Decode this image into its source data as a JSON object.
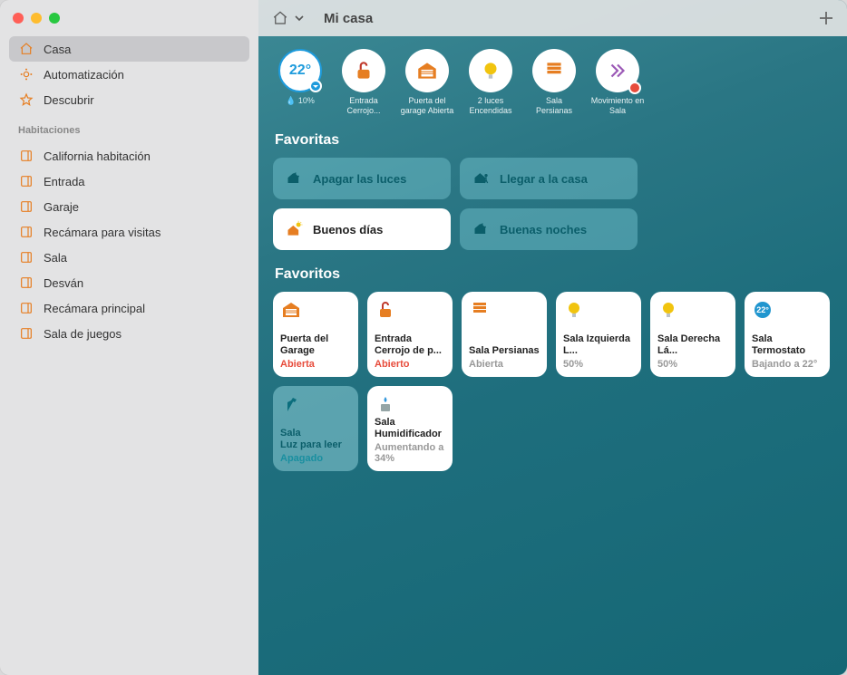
{
  "window": {
    "title": "Mi casa"
  },
  "sidebar": {
    "top": [
      {
        "label": "Casa",
        "icon": "home",
        "selected": true
      },
      {
        "label": "Automatización",
        "icon": "auto",
        "selected": false
      },
      {
        "label": "Descubrir",
        "icon": "star",
        "selected": false
      }
    ],
    "rooms_header": "Habitaciones",
    "rooms": [
      {
        "label": "California habitación"
      },
      {
        "label": "Entrada"
      },
      {
        "label": "Garaje"
      },
      {
        "label": "Recámara para visitas"
      },
      {
        "label": "Sala"
      },
      {
        "label": "Desván"
      },
      {
        "label": "Recámara principal"
      },
      {
        "label": "Sala de juegos"
      }
    ]
  },
  "status": {
    "temp": "22°",
    "humidity": "10%",
    "chips": [
      {
        "label": "Entrada Cerrojo... Abierto",
        "icon": "lock-open"
      },
      {
        "label": "Puerta del garage Abierta",
        "icon": "garage"
      },
      {
        "label": "2 luces Encendidas",
        "icon": "bulb"
      },
      {
        "label": "Sala Persianas Abierta",
        "icon": "blinds"
      },
      {
        "label": "Movimiento en Sala",
        "icon": "motion",
        "alert": true
      }
    ]
  },
  "scenes_header": "Favoritas",
  "scenes": [
    {
      "label": "Apagar las luces",
      "style": "dim"
    },
    {
      "label": "Llegar a la casa",
      "style": "dim"
    },
    {
      "label": "Buenos días",
      "style": "on"
    },
    {
      "label": "Buenas noches",
      "style": "dim"
    }
  ],
  "favorites_header": "Favoritos",
  "favorites": [
    {
      "name": "Puerta del Garage",
      "status": "Abierta",
      "statusClass": "stat-red",
      "icon": "garage",
      "off": false
    },
    {
      "name": "Entrada Cerrojo de p...",
      "status": "Abierto",
      "statusClass": "stat-red",
      "icon": "lock-open",
      "off": false
    },
    {
      "name": "Sala Persianas",
      "status": "Abierta",
      "statusClass": "stat-gray",
      "icon": "blinds",
      "off": false
    },
    {
      "name": "Sala Izquierda L...",
      "status": "50%",
      "statusClass": "stat-gray",
      "icon": "bulb",
      "off": false
    },
    {
      "name": "Sala Derecha Lá...",
      "status": "50%",
      "statusClass": "stat-gray",
      "icon": "bulb",
      "off": false
    },
    {
      "name": "Sala Termostato",
      "status": "Bajando a 22°",
      "statusClass": "stat-gray",
      "icon": "thermo",
      "off": false
    },
    {
      "name": "Sala\nLuz para leer",
      "status": "Apagado",
      "statusClass": "stat-teal",
      "icon": "lamp",
      "off": true
    },
    {
      "name": "Sala Humidificador",
      "status": "Aumentando a 34%",
      "statusClass": "stat-gray",
      "icon": "humid",
      "off": false
    }
  ]
}
